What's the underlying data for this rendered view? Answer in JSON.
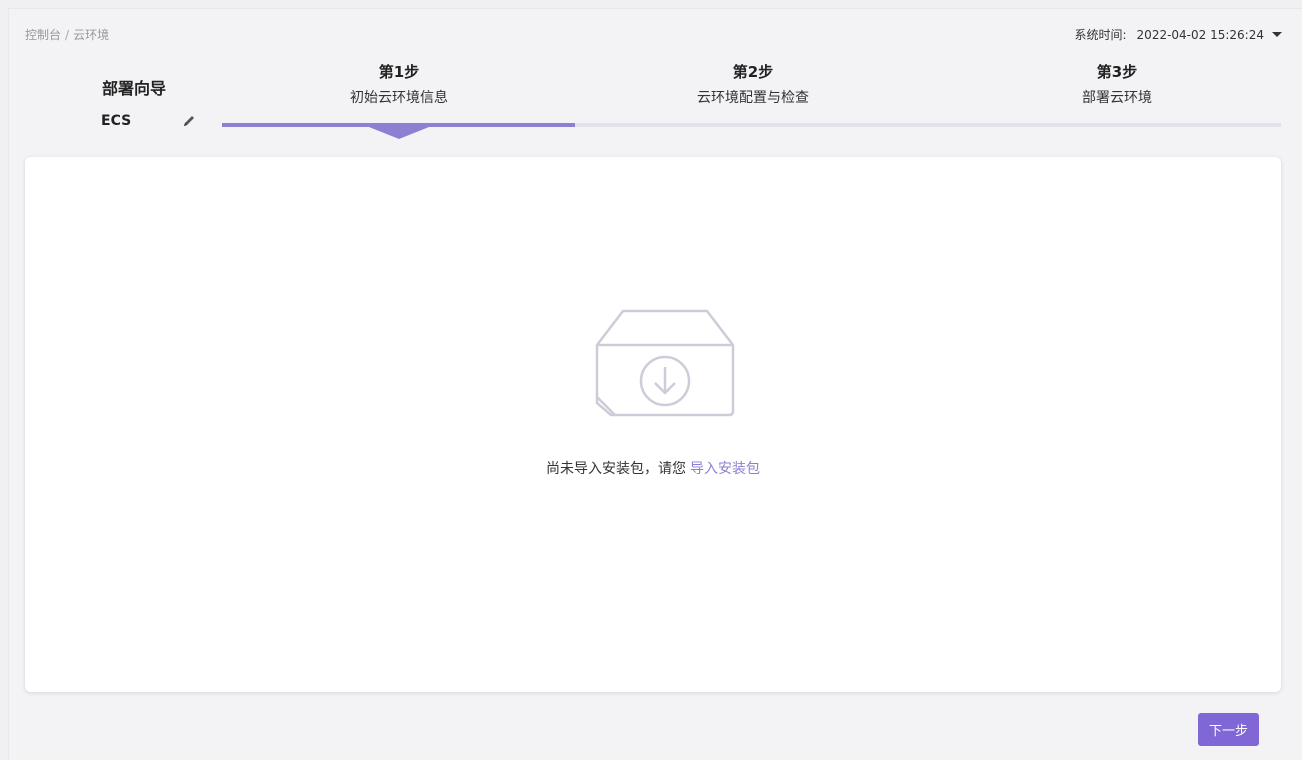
{
  "breadcrumb": {
    "items": [
      "控制台",
      "云环境"
    ],
    "separator": "/"
  },
  "system_time": {
    "label": "系统时间:",
    "value": "2022-04-02 15:26:24"
  },
  "wizard": {
    "title": "部署向导",
    "name": "ECS",
    "edit_icon": "pencil-icon"
  },
  "steps": [
    {
      "number": "第1步",
      "label": "初始云环境信息",
      "active": true
    },
    {
      "number": "第2步",
      "label": "云环境配置与检查",
      "active": false
    },
    {
      "number": "第3步",
      "label": "部署云环境",
      "active": false
    }
  ],
  "progress": {
    "current_step": 1,
    "total_steps": 3
  },
  "empty_state": {
    "icon": "download-box-icon",
    "message": "尚未导入安装包，请您",
    "link_label": "导入安装包"
  },
  "footer": {
    "next_label": "下一步"
  },
  "colors": {
    "accent": "#8f7fd3",
    "button": "#8167d6",
    "track": "#e2e2ea",
    "background": "#f3f3f6"
  }
}
